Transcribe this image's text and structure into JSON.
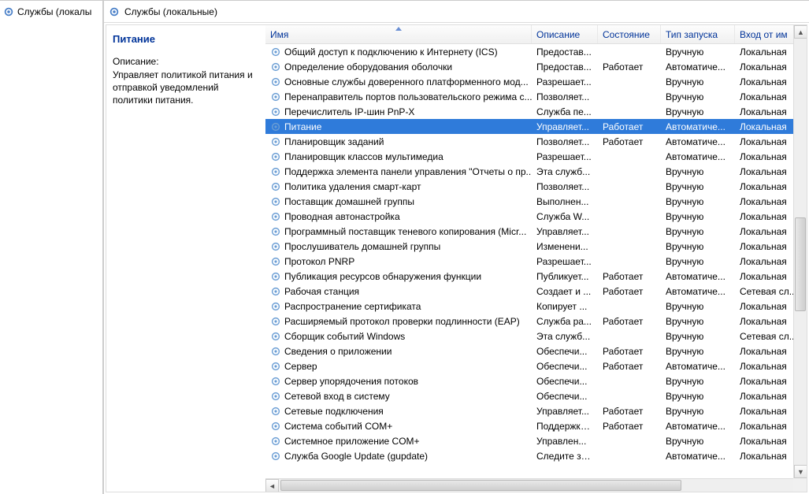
{
  "left_header": "Службы (локалы",
  "right_header": "Службы (локальные)",
  "detail": {
    "selected_name": "Питание",
    "desc_label": "Описание:",
    "desc_text": "Управляет политикой питания и отправкой уведомлений политики питания."
  },
  "columns": {
    "name": "Имя",
    "desc": "Описание",
    "state": "Состояние",
    "startup": "Тип запуска",
    "logon": "Вход от им"
  },
  "services": [
    {
      "name": "Общий доступ к подключению к Интернету (ICS)",
      "desc": "Предостав...",
      "state": "",
      "startup": "Вручную",
      "logon": "Локальная"
    },
    {
      "name": "Определение оборудования оболочки",
      "desc": "Предостав...",
      "state": "Работает",
      "startup": "Автоматиче...",
      "logon": "Локальная"
    },
    {
      "name": "Основные службы доверенного платформенного мод...",
      "desc": "Разрешает...",
      "state": "",
      "startup": "Вручную",
      "logon": "Локальная"
    },
    {
      "name": "Перенаправитель портов пользовательского режима с...",
      "desc": "Позволяет...",
      "state": "",
      "startup": "Вручную",
      "logon": "Локальная"
    },
    {
      "name": "Перечислитель IP-шин PnP-X",
      "desc": "Служба пе...",
      "state": "",
      "startup": "Вручную",
      "logon": "Локальная"
    },
    {
      "name": "Питание",
      "desc": "Управляет...",
      "state": "Работает",
      "startup": "Автоматиче...",
      "logon": "Локальная",
      "selected": true
    },
    {
      "name": "Планировщик заданий",
      "desc": "Позволяет...",
      "state": "Работает",
      "startup": "Автоматиче...",
      "logon": "Локальная"
    },
    {
      "name": "Планировщик классов мультимедиа",
      "desc": "Разрешает...",
      "state": "",
      "startup": "Автоматиче...",
      "logon": "Локальная"
    },
    {
      "name": "Поддержка элемента панели управления \"Отчеты о пр...",
      "desc": "Эта служб...",
      "state": "",
      "startup": "Вручную",
      "logon": "Локальная"
    },
    {
      "name": "Политика удаления смарт-карт",
      "desc": "Позволяет...",
      "state": "",
      "startup": "Вручную",
      "logon": "Локальная"
    },
    {
      "name": "Поставщик домашней группы",
      "desc": "Выполнен...",
      "state": "",
      "startup": "Вручную",
      "logon": "Локальная"
    },
    {
      "name": "Проводная автонастройка",
      "desc": "Служба W...",
      "state": "",
      "startup": "Вручную",
      "logon": "Локальная"
    },
    {
      "name": "Программный поставщик теневого копирования (Micr...",
      "desc": "Управляет...",
      "state": "",
      "startup": "Вручную",
      "logon": "Локальная"
    },
    {
      "name": "Прослушиватель домашней группы",
      "desc": "Изменени...",
      "state": "",
      "startup": "Вручную",
      "logon": "Локальная"
    },
    {
      "name": "Протокол PNRP",
      "desc": "Разрешает...",
      "state": "",
      "startup": "Вручную",
      "logon": "Локальная"
    },
    {
      "name": "Публикация ресурсов обнаружения функции",
      "desc": "Публикует...",
      "state": "Работает",
      "startup": "Автоматиче...",
      "logon": "Локальная"
    },
    {
      "name": "Рабочая станция",
      "desc": "Создает и ...",
      "state": "Работает",
      "startup": "Автоматиче...",
      "logon": "Сетевая сл..."
    },
    {
      "name": "Распространение сертификата",
      "desc": "Копирует ...",
      "state": "",
      "startup": "Вручную",
      "logon": "Локальная"
    },
    {
      "name": "Расширяемый протокол проверки подлинности (EAP)",
      "desc": "Служба ра...",
      "state": "Работает",
      "startup": "Вручную",
      "logon": "Локальная"
    },
    {
      "name": "Сборщик событий Windows",
      "desc": "Эта служб...",
      "state": "",
      "startup": "Вручную",
      "logon": "Сетевая сл..."
    },
    {
      "name": "Сведения о приложении",
      "desc": "Обеспечи...",
      "state": "Работает",
      "startup": "Вручную",
      "logon": "Локальная"
    },
    {
      "name": "Сервер",
      "desc": "Обеспечи...",
      "state": "Работает",
      "startup": "Автоматиче...",
      "logon": "Локальная"
    },
    {
      "name": "Сервер упорядочения потоков",
      "desc": "Обеспечи...",
      "state": "",
      "startup": "Вручную",
      "logon": "Локальная"
    },
    {
      "name": "Сетевой вход в систему",
      "desc": "Обеспечи...",
      "state": "",
      "startup": "Вручную",
      "logon": "Локальная"
    },
    {
      "name": "Сетевые подключения",
      "desc": "Управляет...",
      "state": "Работает",
      "startup": "Вручную",
      "logon": "Локальная"
    },
    {
      "name": "Система событий COM+",
      "desc": "Поддержка...",
      "state": "Работает",
      "startup": "Автоматиче...",
      "logon": "Локальная"
    },
    {
      "name": "Системное приложение COM+",
      "desc": "Управлен...",
      "state": "",
      "startup": "Вручную",
      "logon": "Локальная"
    },
    {
      "name": "Служба Google Update (gupdate)",
      "desc": "Следите за...",
      "state": "",
      "startup": "Автоматиче...",
      "logon": "Локальная"
    }
  ]
}
